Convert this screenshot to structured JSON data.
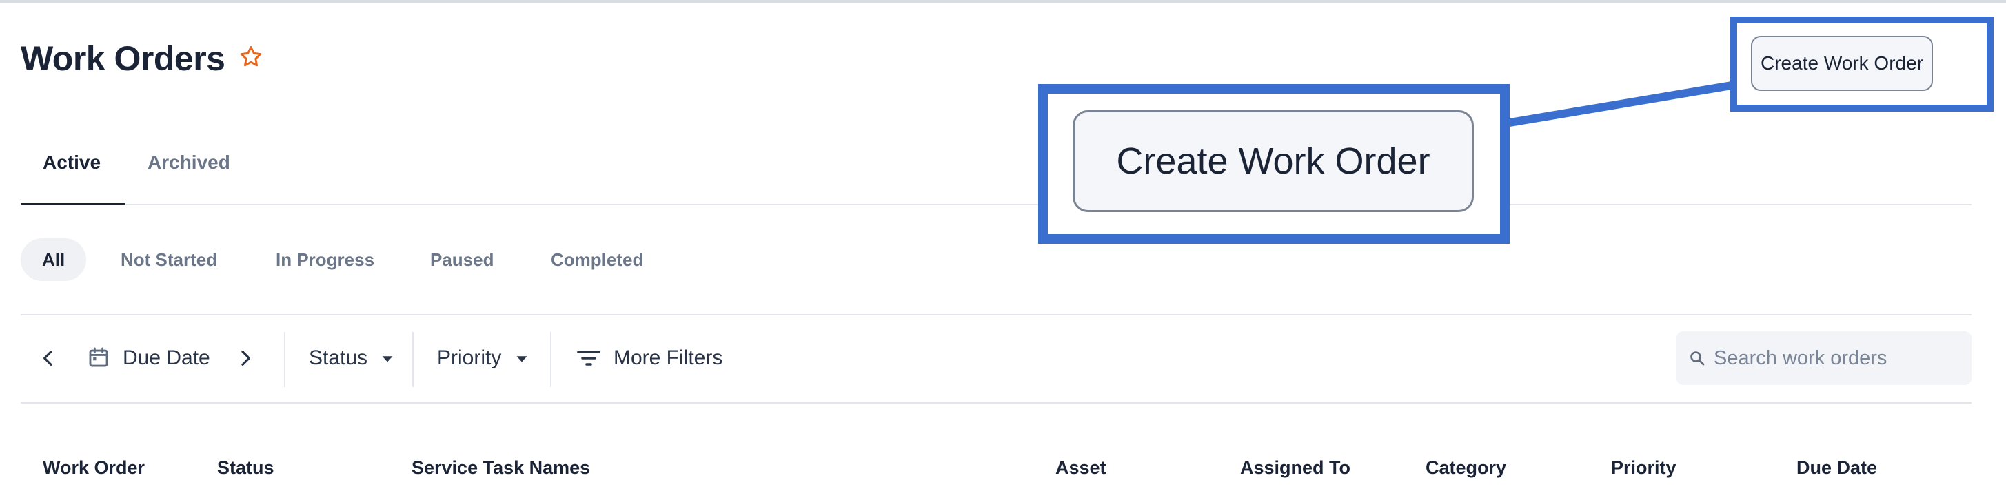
{
  "header": {
    "title": "Work Orders",
    "create_button_label": "Create Work Order",
    "favorite_icon": "star-outline-icon",
    "favorite_color": "#e8651a"
  },
  "tabs": [
    {
      "label": "Active",
      "selected": true
    },
    {
      "label": "Archived",
      "selected": false
    }
  ],
  "status_chips": [
    {
      "label": "All",
      "selected": true
    },
    {
      "label": "Not Started",
      "selected": false
    },
    {
      "label": "In Progress",
      "selected": false
    },
    {
      "label": "Paused",
      "selected": false
    },
    {
      "label": "Completed",
      "selected": false
    }
  ],
  "toolbar": {
    "prev_icon": "chevron-left-icon",
    "next_icon": "chevron-right-icon",
    "date_icon": "calendar-icon",
    "date_label": "Due Date",
    "status_label": "Status",
    "priority_label": "Priority",
    "more_filters_label": "More Filters",
    "more_filters_icon": "filter-lines-icon",
    "search_placeholder": "Search work orders"
  },
  "table": {
    "columns": [
      "Work Order",
      "Status",
      "Service Task Names",
      "Asset",
      "Assigned To",
      "Category",
      "Priority",
      "Due Date"
    ]
  },
  "highlight": {
    "color": "#3a6fd0",
    "zoom_label": "Create Work Order"
  }
}
